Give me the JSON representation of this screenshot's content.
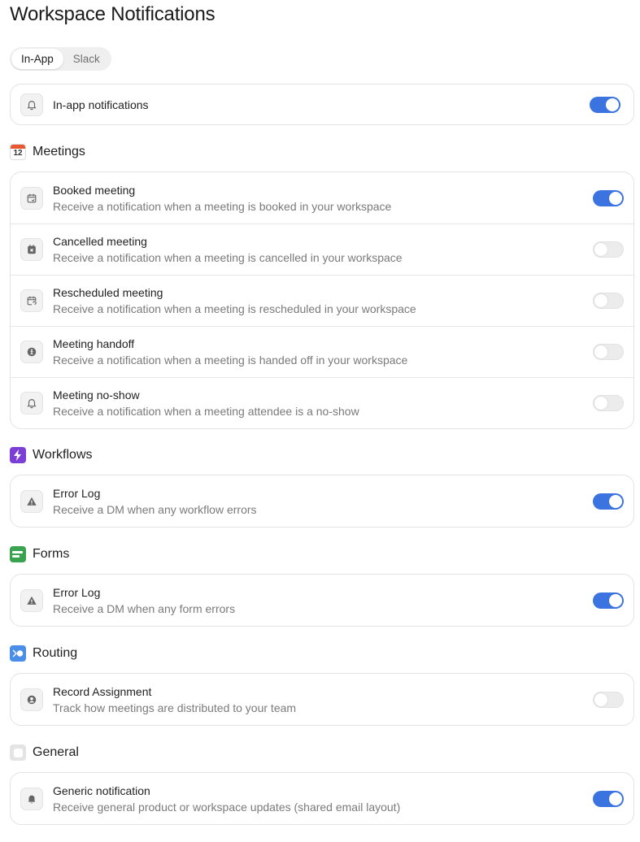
{
  "page": {
    "title": "Workspace Notifications"
  },
  "tabs": [
    {
      "label": "In-App",
      "active": true
    },
    {
      "label": "Slack",
      "active": false
    }
  ],
  "inapp": {
    "title": "In-app notifications",
    "enabled": true,
    "icon": "bell-icon"
  },
  "sections": {
    "meetings": {
      "label": "Meetings",
      "icon": "calendar-12-icon",
      "icon_text": "12",
      "items": [
        {
          "title": "Booked meeting",
          "desc": "Receive a notification when a meeting is booked in your workspace",
          "enabled": true,
          "icon": "calendar-check-icon"
        },
        {
          "title": "Cancelled meeting",
          "desc": "Receive a notification when a meeting is cancelled in your workspace",
          "enabled": false,
          "icon": "calendar-x-icon"
        },
        {
          "title": "Rescheduled meeting",
          "desc": "Receive a notification when a meeting is rescheduled in your workspace",
          "enabled": false,
          "icon": "calendar-refresh-icon"
        },
        {
          "title": "Meeting handoff",
          "desc": "Receive a notification when a meeting is handed off in your workspace",
          "enabled": false,
          "icon": "handoff-icon"
        },
        {
          "title": "Meeting no-show",
          "desc": "Receive a notification when a meeting attendee is a no-show",
          "enabled": false,
          "icon": "bell-icon"
        }
      ]
    },
    "workflows": {
      "label": "Workflows",
      "icon": "lightning-icon",
      "items": [
        {
          "title": "Error Log",
          "desc": "Receive a DM when any workflow errors",
          "enabled": true,
          "icon": "warning-icon"
        }
      ]
    },
    "forms": {
      "label": "Forms",
      "icon": "form-icon",
      "items": [
        {
          "title": "Error Log",
          "desc": "Receive a DM when any form errors",
          "enabled": true,
          "icon": "warning-icon"
        }
      ]
    },
    "routing": {
      "label": "Routing",
      "icon": "routing-icon",
      "items": [
        {
          "title": "Record Assignment",
          "desc": "Track how meetings are distributed to your team",
          "enabled": false,
          "icon": "user-circle-icon"
        }
      ]
    },
    "general": {
      "label": "General",
      "icon": "general-icon",
      "items": [
        {
          "title": "Generic notification",
          "desc": "Receive general product or workspace updates (shared email layout)",
          "enabled": true,
          "icon": "bell-filled-icon"
        }
      ]
    }
  },
  "colors": {
    "toggle_on": "#3b74e0",
    "toggle_off": "#ececec",
    "meetings_accent": "#e8572f",
    "workflows_accent": "#7b3fd6",
    "forms_accent": "#3aa34f",
    "routing_accent": "#4a8ee8"
  }
}
